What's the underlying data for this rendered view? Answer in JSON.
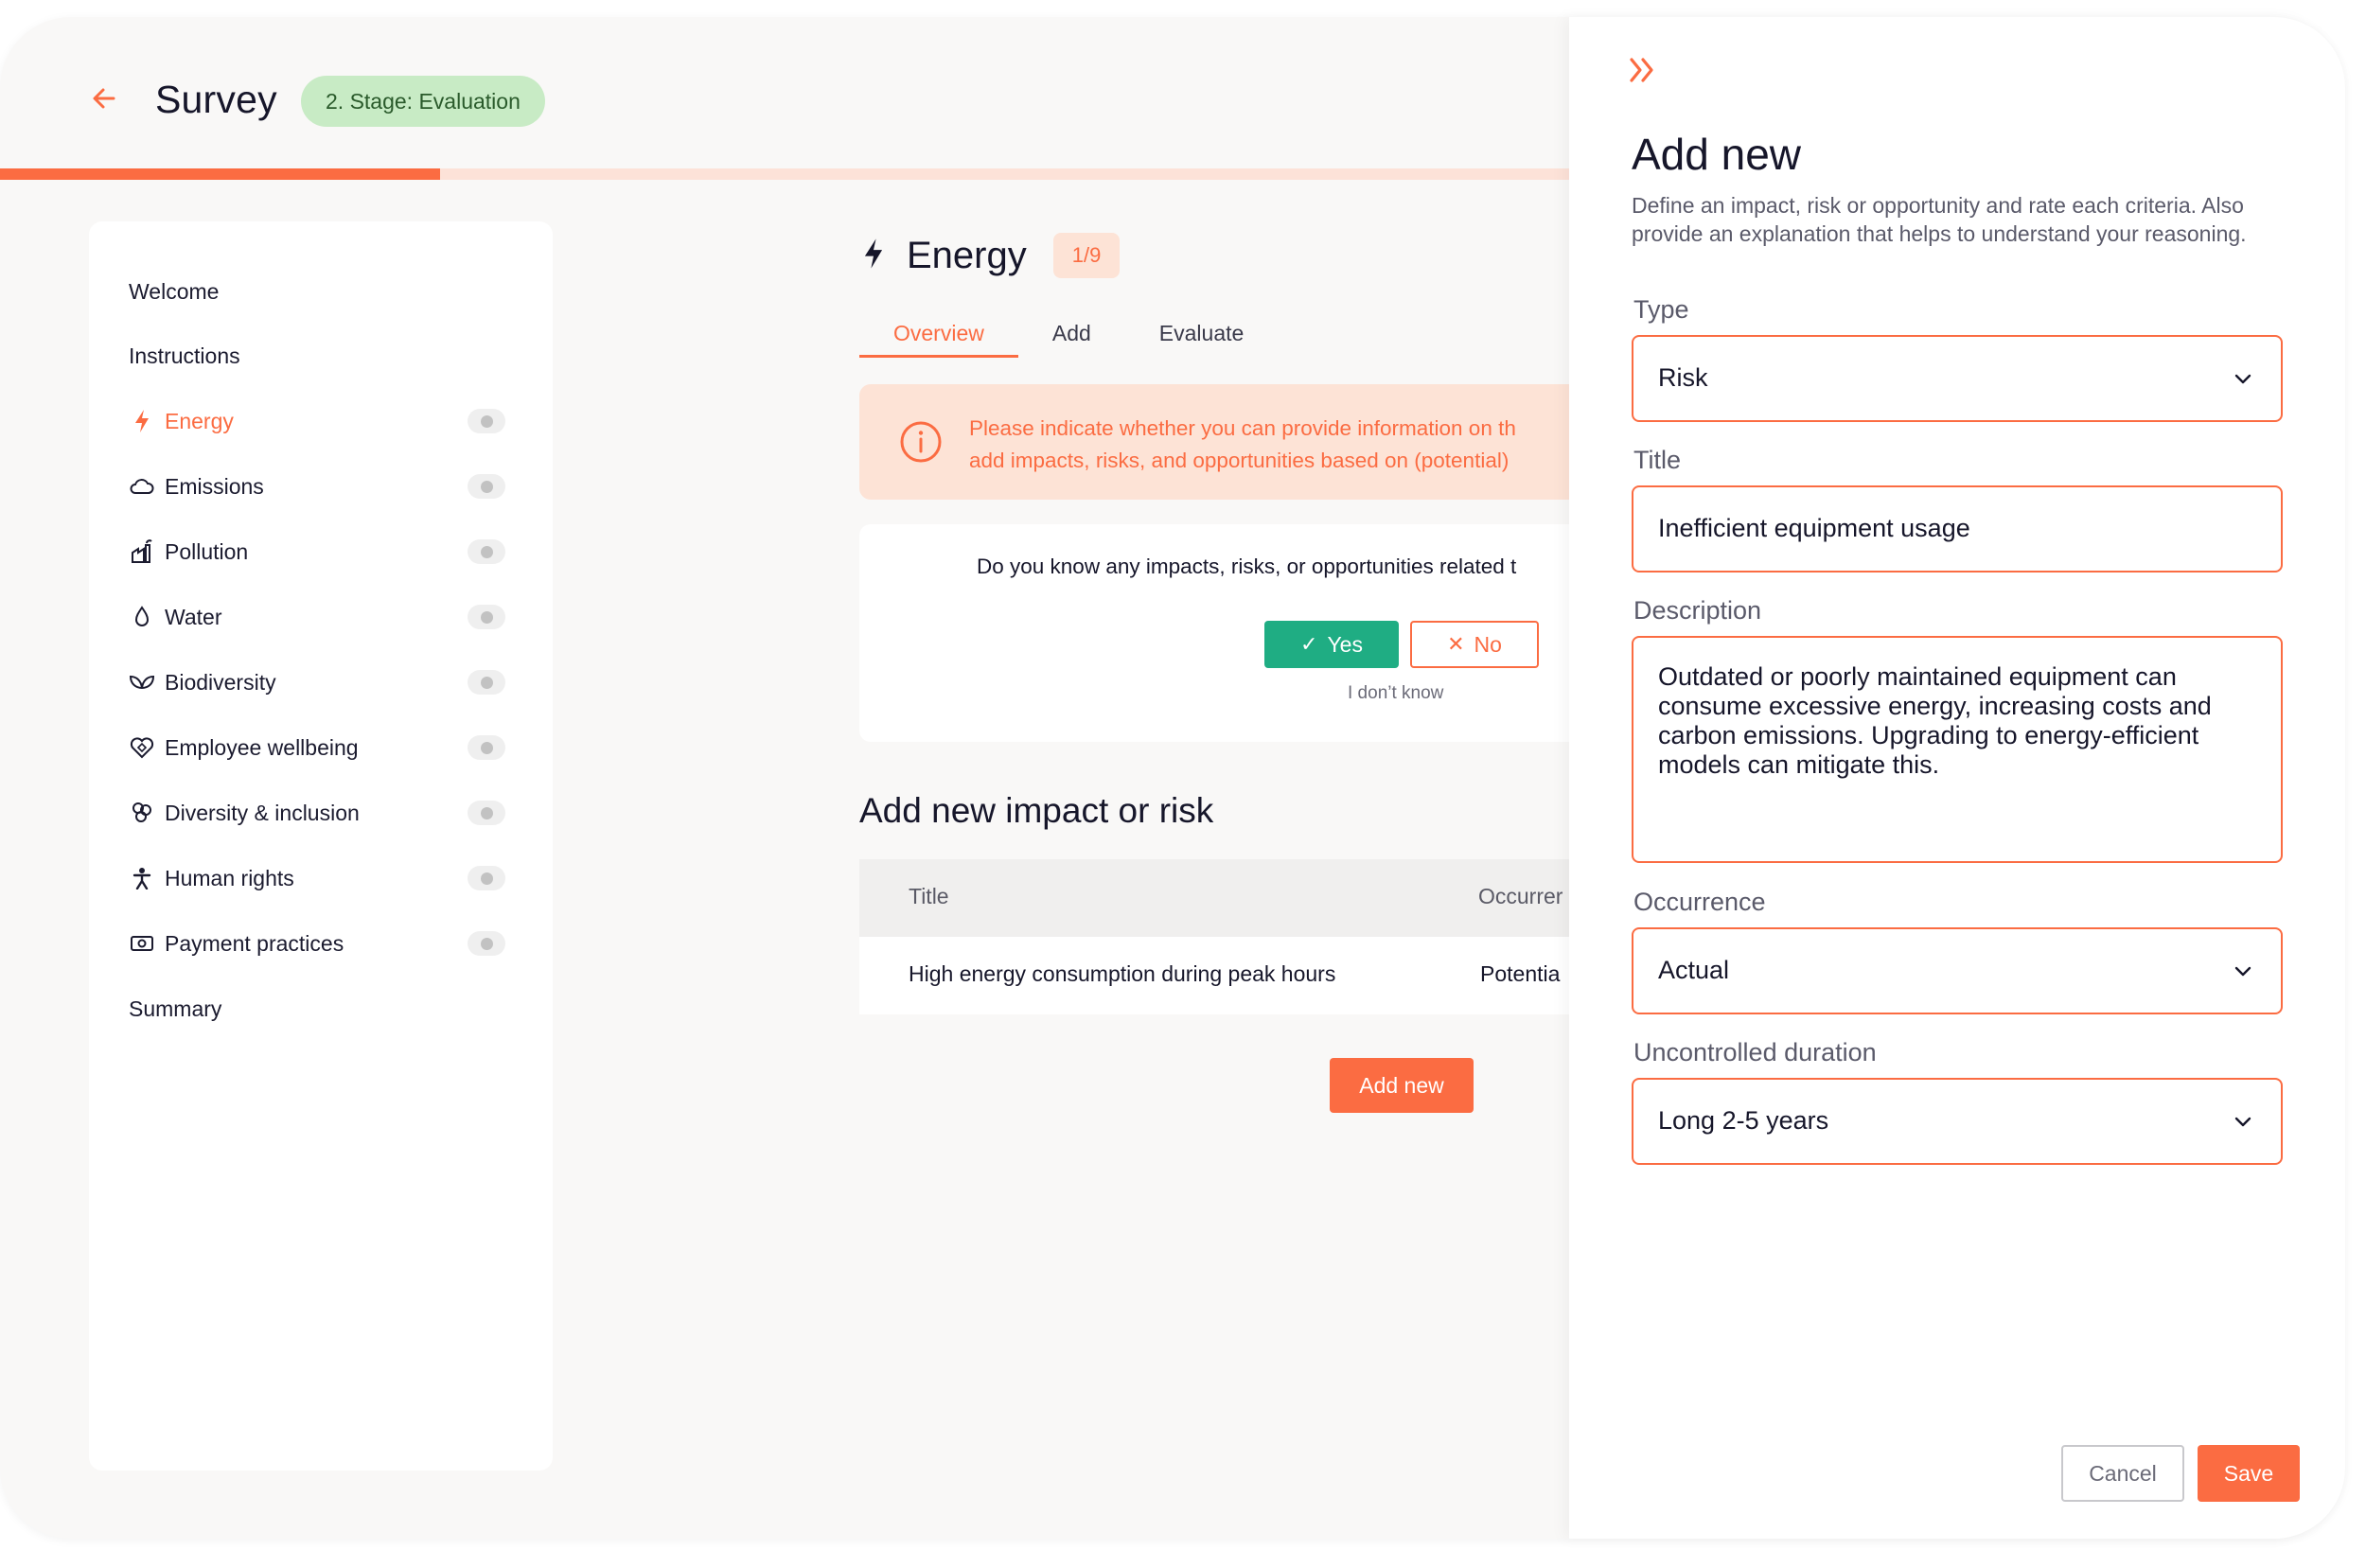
{
  "header": {
    "title": "Survey",
    "stage": "2. Stage: Evaluation",
    "progress_fraction": 0.28
  },
  "sidebar": {
    "items": [
      {
        "label": "Welcome",
        "icon": "none",
        "toggle": false
      },
      {
        "label": "Instructions",
        "icon": "none",
        "toggle": false
      },
      {
        "label": "Energy",
        "icon": "lightning-icon",
        "toggle": true,
        "active": true
      },
      {
        "label": "Emissions",
        "icon": "cloud-icon",
        "toggle": true
      },
      {
        "label": "Pollution",
        "icon": "factory-icon",
        "toggle": true
      },
      {
        "label": "Water",
        "icon": "droplet-icon",
        "toggle": true
      },
      {
        "label": "Biodiversity",
        "icon": "leaf-icon",
        "toggle": true
      },
      {
        "label": "Employee wellbeing",
        "icon": "heart-icon",
        "toggle": true
      },
      {
        "label": "Diversity & inclusion",
        "icon": "people-icon",
        "toggle": true
      },
      {
        "label": "Human rights",
        "icon": "person-icon",
        "toggle": true
      },
      {
        "label": "Payment practices",
        "icon": "banknote-icon",
        "toggle": true
      },
      {
        "label": "Summary",
        "icon": "none",
        "toggle": false
      }
    ]
  },
  "main": {
    "section": "Energy",
    "counter": "1/9",
    "tabs": [
      {
        "label": "Overview",
        "active": true
      },
      {
        "label": "Add"
      },
      {
        "label": "Evaluate"
      }
    ],
    "info": {
      "line1": "Please indicate whether you can provide information on th",
      "line2": "add impacts, risks, and opportunities based on (potential)"
    },
    "question": {
      "text": "Do you know any impacts, risks, or opportunities related t",
      "yes": "Yes",
      "no": "No",
      "dont_know": "I don’t know"
    },
    "add_section_title": "Add new impact or risk",
    "table": {
      "columns": [
        "Title",
        "Occurrer"
      ],
      "rows": [
        [
          "High energy consumption during peak hours",
          "Potentia"
        ]
      ]
    },
    "add_button": "Add new"
  },
  "panel": {
    "title": "Add new",
    "description": "Define an impact, risk or opportunity and rate each criteria. Also provide an explanation that helps to understand your reasoning.",
    "fields": {
      "type": {
        "label": "Type",
        "value": "Risk"
      },
      "title": {
        "label": "Title",
        "value": "Inefficient equipment usage"
      },
      "description": {
        "label": "Description",
        "value": "Outdated or poorly maintained equipment can consume excessive energy, increasing costs and carbon emissions. Upgrading to energy-efficient models can mitigate this."
      },
      "occurrence": {
        "label": "Occurrence",
        "value": "Actual"
      },
      "duration": {
        "label": "Uncontrolled duration",
        "value": "Long 2-5 years"
      }
    },
    "cancel": "Cancel",
    "save": "Save"
  },
  "colors": {
    "accent": "#fb6c42",
    "success": "#1fad83",
    "stage_badge_bg": "#c8ebc5",
    "info_bg": "#fde3d6"
  }
}
